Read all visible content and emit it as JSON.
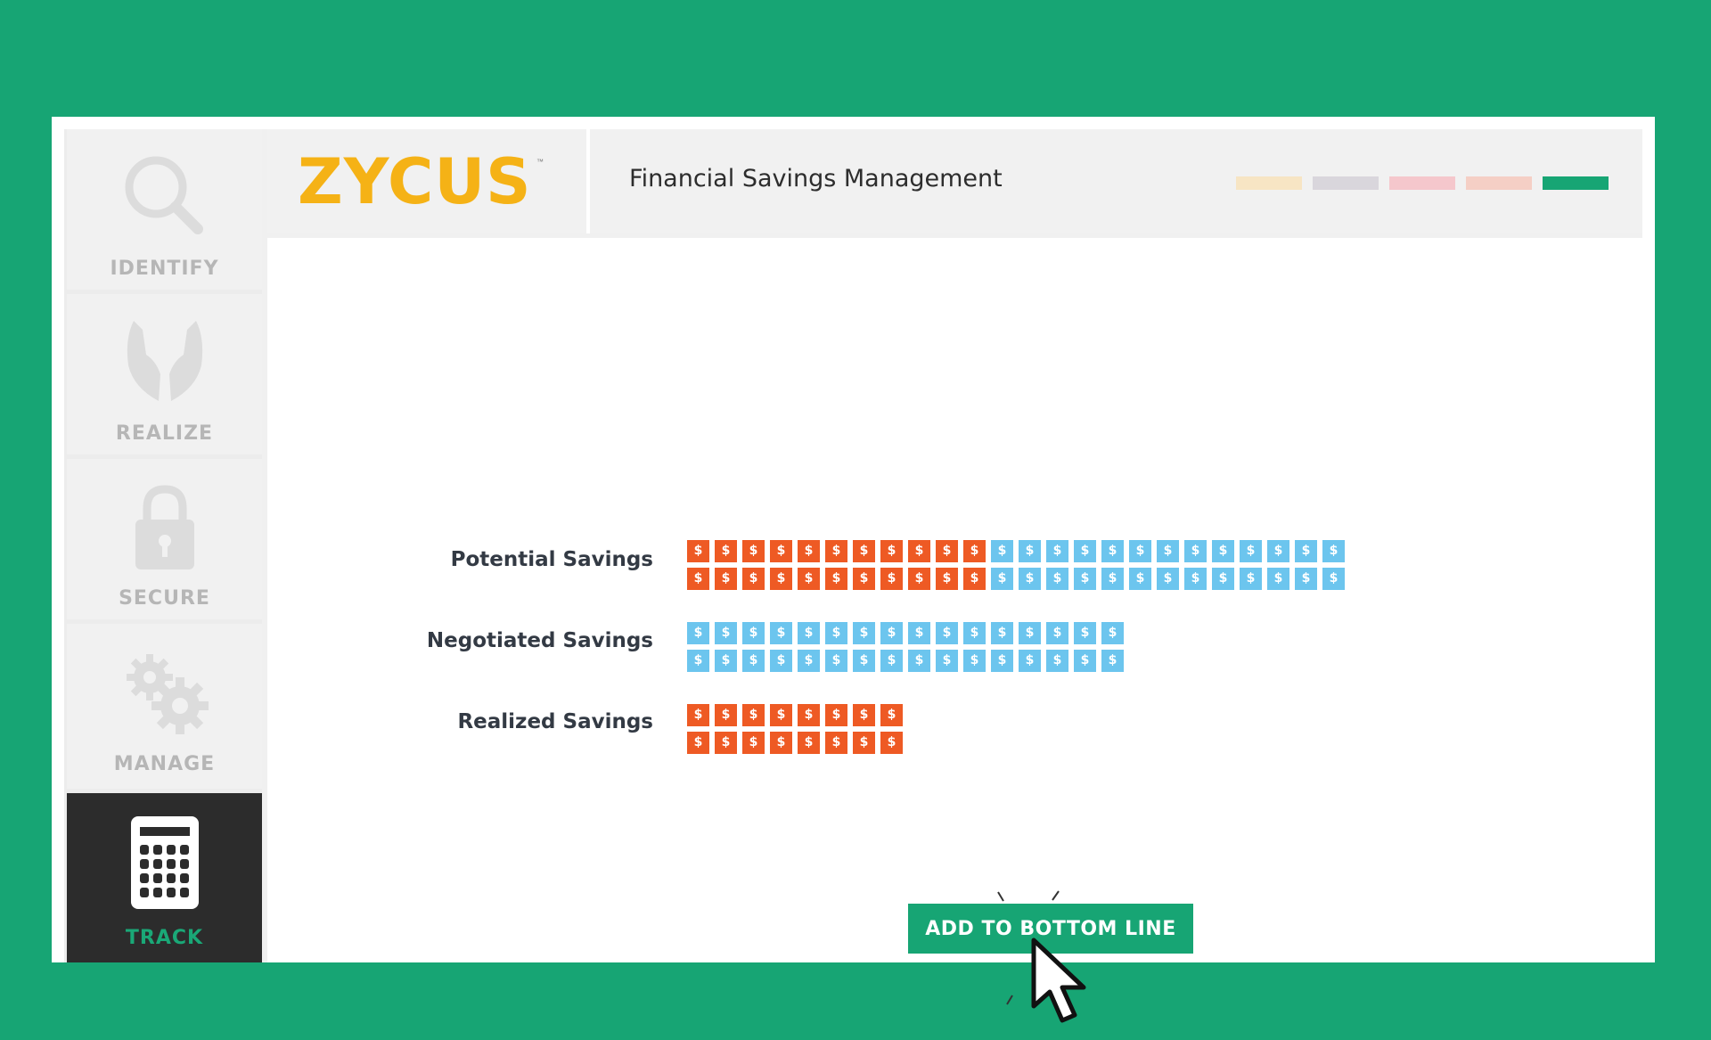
{
  "brand": {
    "logo_text": "ZYCUS",
    "tm": "™",
    "logo_color": "#f5b216"
  },
  "header": {
    "title": "Financial Savings Management",
    "step_colors": [
      "#f7e5c4",
      "#d9d6dc",
      "#f5c7cc",
      "#f5cfc5",
      "#17a574"
    ]
  },
  "sidebar": {
    "items": [
      {
        "label": "IDENTIFY",
        "icon": "magnifier-icon"
      },
      {
        "label": "REALIZE",
        "icon": "hands-icon"
      },
      {
        "label": "SECURE",
        "icon": "lock-icon"
      },
      {
        "label": "MANAGE",
        "icon": "gears-icon"
      },
      {
        "label": "TRACK",
        "icon": "calculator-icon",
        "active": true
      }
    ]
  },
  "savings": {
    "coin_symbol": "$",
    "rows": [
      {
        "label": "Potential Savings",
        "orange_per_line": 11,
        "blue_per_line": 13
      },
      {
        "label": "Negotiated Savings",
        "orange_per_line": 0,
        "blue_per_line": 16
      },
      {
        "label": "Realized Savings",
        "orange_per_line": 8,
        "blue_per_line": 0
      }
    ],
    "colors": {
      "orange": "#ee5a24",
      "blue": "#6cc5ee"
    }
  },
  "cta": {
    "label": "ADD TO BOTTOM LINE"
  }
}
